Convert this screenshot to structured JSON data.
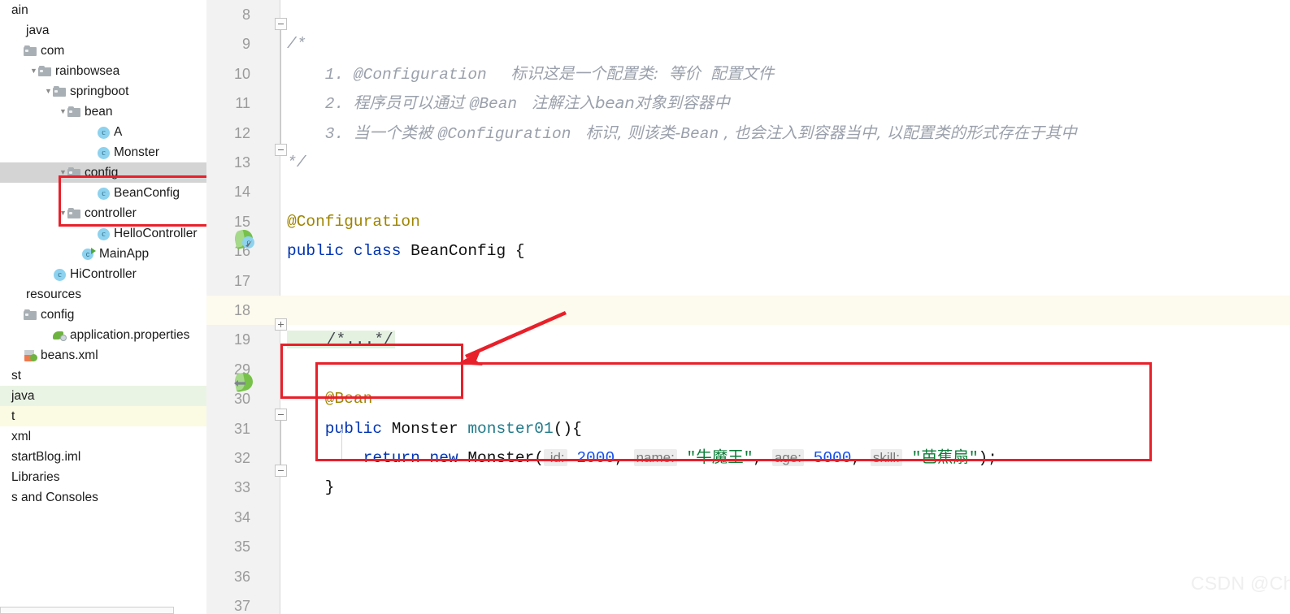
{
  "sidebar": {
    "name": "project-tree",
    "hscroll_label": "horizontal-scrollbar",
    "items": [
      {
        "label": "ain",
        "indent": 0,
        "twisty": "",
        "icon": "none",
        "row": "plain"
      },
      {
        "label": "java",
        "indent": 1,
        "twisty": "",
        "icon": "none",
        "row": "plain"
      },
      {
        "label": "com",
        "indent": 1,
        "twisty": "",
        "icon": "folder",
        "row": "plain"
      },
      {
        "label": "rainbowsea",
        "indent": 2,
        "twisty": "▼",
        "icon": "folder",
        "row": "plain"
      },
      {
        "label": "springboot",
        "indent": 3,
        "twisty": "▼",
        "icon": "folder",
        "row": "plain"
      },
      {
        "label": "bean",
        "indent": 4,
        "twisty": "▼",
        "icon": "folder",
        "row": "plain"
      },
      {
        "label": "A",
        "indent": 6,
        "twisty": "",
        "icon": "class",
        "row": "plain"
      },
      {
        "label": "Monster",
        "indent": 6,
        "twisty": "",
        "icon": "class",
        "row": "plain"
      },
      {
        "label": "config",
        "indent": 4,
        "twisty": "▼",
        "icon": "folder",
        "row": "selected"
      },
      {
        "label": "BeanConfig",
        "indent": 6,
        "twisty": "",
        "icon": "class",
        "row": "plain"
      },
      {
        "label": "controller",
        "indent": 4,
        "twisty": "▼",
        "icon": "folder",
        "row": "plain"
      },
      {
        "label": "HelloController",
        "indent": 6,
        "twisty": "",
        "icon": "class",
        "row": "plain"
      },
      {
        "label": "MainApp",
        "indent": 5,
        "twisty": "",
        "icon": "mainapp",
        "row": "plain"
      },
      {
        "label": "HiController",
        "indent": 3,
        "twisty": "",
        "icon": "class",
        "row": "plain"
      },
      {
        "label": "resources",
        "indent": 1,
        "twisty": "",
        "icon": "none",
        "row": "plain"
      },
      {
        "label": "config",
        "indent": 1,
        "twisty": "",
        "icon": "folder",
        "row": "plain"
      },
      {
        "label": "application.properties",
        "indent": 3,
        "twisty": "",
        "icon": "props",
        "row": "plain"
      },
      {
        "label": "beans.xml",
        "indent": 1,
        "twisty": "",
        "icon": "xml",
        "row": "plain"
      },
      {
        "label": "st",
        "indent": 0,
        "twisty": "",
        "icon": "none",
        "row": "plain"
      },
      {
        "label": "java",
        "indent": 0,
        "twisty": "",
        "icon": "none",
        "row": "green"
      },
      {
        "label": "t",
        "indent": 0,
        "twisty": "",
        "icon": "none",
        "row": "yellowish"
      },
      {
        "label": "xml",
        "indent": 0,
        "twisty": "",
        "icon": "none",
        "row": "plain"
      },
      {
        "label": "startBlog.iml",
        "indent": 0,
        "twisty": "",
        "icon": "none",
        "row": "plain"
      },
      {
        "label": "Libraries",
        "indent": 0,
        "twisty": "",
        "icon": "none",
        "row": "plain"
      },
      {
        "label": "s and Consoles",
        "indent": 0,
        "twisty": "",
        "icon": "none",
        "row": "plain"
      }
    ]
  },
  "editor": {
    "name": "code-editor",
    "lines": [
      {
        "num": "8",
        "caret": false,
        "segments": []
      },
      {
        "num": "9",
        "caret": false,
        "segments": [
          {
            "cls": "cmt",
            "text": "/*"
          }
        ]
      },
      {
        "num": "10",
        "caret": false,
        "segments": [
          {
            "cls": "cmt",
            "text": "    1. @Configuration  "
          },
          {
            "cls": "cmt-cjk",
            "text": " 标识这是一个配置类:  等价  配置文件"
          }
        ]
      },
      {
        "num": "11",
        "caret": false,
        "segments": [
          {
            "cls": "cmt",
            "text": "    2. "
          },
          {
            "cls": "cmt-cjk",
            "text": "程序员可以通过 "
          },
          {
            "cls": "cmt",
            "text": "@Bean "
          },
          {
            "cls": "cmt-cjk",
            "text": " 注解注入bean对象到容器中"
          }
        ]
      },
      {
        "num": "12",
        "caret": false,
        "segments": [
          {
            "cls": "cmt",
            "text": "    3. "
          },
          {
            "cls": "cmt-cjk",
            "text": "当一个类被 "
          },
          {
            "cls": "cmt",
            "text": "@Configuration "
          },
          {
            "cls": "cmt-cjk",
            "text": " 标识, 则该类-"
          },
          {
            "cls": "cmt",
            "text": "Bean"
          },
          {
            "cls": "cmt-cjk",
            "text": " , 也会注入到容器当中, 以配置类的形式存在于其中"
          }
        ]
      },
      {
        "num": "13",
        "caret": false,
        "segments": [
          {
            "cls": "cmt",
            "text": "*/"
          }
        ]
      },
      {
        "num": "14",
        "caret": false,
        "segments": []
      },
      {
        "num": "15",
        "caret": false,
        "segments": [
          {
            "cls": "ann",
            "text": "@Configuration"
          }
        ]
      },
      {
        "num": "16",
        "caret": false,
        "segments": [
          {
            "cls": "kw",
            "text": "public class "
          },
          {
            "cls": "typ",
            "text": "BeanConfig {"
          }
        ]
      },
      {
        "num": "17",
        "caret": false,
        "segments": []
      },
      {
        "num": "18",
        "caret": true,
        "segments": []
      },
      {
        "num": "19",
        "caret": false,
        "segments": [
          {
            "cls": "fold-ph",
            "text": "    /*...*/"
          }
        ]
      },
      {
        "num": "29",
        "caret": false,
        "segments": []
      },
      {
        "num": "30",
        "caret": false,
        "segments": [
          {
            "cls": "ann",
            "text": "    @Bean"
          }
        ]
      },
      {
        "num": "31",
        "caret": false,
        "segments": [
          {
            "cls": "kw",
            "text": "    public "
          },
          {
            "cls": "typ",
            "text": "Monster "
          },
          {
            "cls": "mth",
            "text": "monster01"
          },
          {
            "cls": "typ",
            "text": "(){"
          }
        ]
      },
      {
        "num": "32",
        "caret": false,
        "segments": [
          {
            "cls": "kw",
            "text": "        return new "
          },
          {
            "cls": "typ",
            "text": "Monster("
          },
          {
            "cls": "hintp",
            "text": " id:"
          },
          {
            "cls": "num",
            "text": " 2000"
          },
          {
            "cls": "typ",
            "text": ", "
          },
          {
            "cls": "hintp",
            "text": "name:"
          },
          {
            "cls": "str",
            "text": " \"牛魔王\""
          },
          {
            "cls": "typ",
            "text": ", "
          },
          {
            "cls": "hintp",
            "text": "age:"
          },
          {
            "cls": "num",
            "text": " 5000"
          },
          {
            "cls": "typ",
            "text": ", "
          },
          {
            "cls": "hintp",
            "text": "skill:"
          },
          {
            "cls": "str",
            "text": " \"芭蕉扇\""
          },
          {
            "cls": "typ",
            "text": ");"
          }
        ]
      },
      {
        "num": "33",
        "caret": false,
        "segments": [
          {
            "cls": "typ",
            "text": "    }"
          }
        ]
      },
      {
        "num": "34",
        "caret": false,
        "segments": []
      },
      {
        "num": "35",
        "caret": false,
        "segments": []
      },
      {
        "num": "36",
        "caret": false,
        "segments": []
      },
      {
        "num": "37",
        "caret": false,
        "segments": []
      }
    ],
    "gutter_icons": [
      {
        "name": "spring-bean-gutter-icon-class",
        "line_index": 9,
        "kind": "bean-class"
      },
      {
        "name": "spring-bean-gutter-icon-method",
        "line_index": 14,
        "kind": "bean-method"
      }
    ]
  },
  "annotations": {
    "tree_box": "red-highlight-box-beanconfig",
    "bean_box": "red-highlight-box-bean-annotation",
    "method_box": "red-highlight-box-monster01-method",
    "arrow": "red-arrow-pointing-to-bean"
  },
  "watermark": {
    "text": "CSDN @ChinaRainbowSea"
  },
  "colors": {
    "accent_red": "#e8202a",
    "annotation": "#9e8400",
    "keyword": "#0033b3",
    "string": "#0a7d37",
    "number": "#1750eb",
    "method": "#227a8a",
    "comment": "#9aa0ab",
    "caret_row": "#fdfaee",
    "selection": "#d4d4d4"
  }
}
